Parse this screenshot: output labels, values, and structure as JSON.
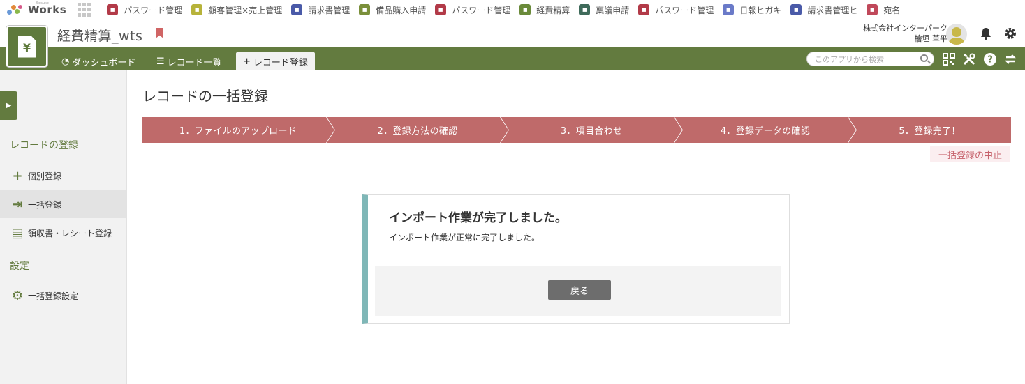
{
  "topbar": {
    "logo_small": "Sosuke",
    "logo_text": "Works",
    "bookmarks": [
      {
        "label": "パスワード管理",
        "icon": "lock-icon",
        "color": "#b23a48"
      },
      {
        "label": "顧客管理×売上管理",
        "icon": "cart-icon",
        "color": "#b7b33a"
      },
      {
        "label": "請求書管理",
        "icon": "invoice-icon",
        "color": "#4a5aa8"
      },
      {
        "label": "備品購入申請",
        "icon": "list-icon",
        "color": "#7a8f3a"
      },
      {
        "label": "パスワード管理",
        "icon": "lock-icon",
        "color": "#b23a48"
      },
      {
        "label": "経費精算",
        "icon": "expense-icon",
        "color": "#6a8a3a"
      },
      {
        "label": "稟議申請",
        "icon": "document-icon",
        "color": "#3f6a5a"
      },
      {
        "label": "パスワード管理",
        "icon": "lock-icon",
        "color": "#b23a48"
      },
      {
        "label": "日報ヒガキ",
        "icon": "notes-icon",
        "color": "#6a7ac8"
      },
      {
        "label": "請求書管理ヒ",
        "icon": "invoice-icon",
        "color": "#4a5aa8"
      },
      {
        "label": "宛名",
        "icon": "compass-icon",
        "color": "#c0485a"
      }
    ]
  },
  "app": {
    "title": "経費精算_wts",
    "icon_glyph": "¥",
    "company": "株式会社インターパーク",
    "user": "檜垣 草平"
  },
  "nav": {
    "tabs": [
      {
        "label": "ダッシュボード",
        "icon": "dashboard-icon",
        "glyph": "◔"
      },
      {
        "label": "レコード一覧",
        "icon": "list-icon",
        "glyph": "☰"
      },
      {
        "label": "レコード登録",
        "icon": "plus-icon",
        "glyph": "+"
      }
    ],
    "search_placeholder": "このアプリから検索"
  },
  "sidebar": {
    "section1": "レコードの登録",
    "items": [
      {
        "label": "個別登録",
        "icon": "plus-icon",
        "glyph": "+"
      },
      {
        "label": "一括登録",
        "icon": "import-icon",
        "glyph": "⇥"
      },
      {
        "label": "領収書・レシート登録",
        "icon": "receipt-icon",
        "glyph": "▤"
      }
    ],
    "section2": "設定",
    "settings_item": {
      "label": "一括登録設定",
      "icon": "gear-icon",
      "glyph": "⚙"
    }
  },
  "main": {
    "page_title": "レコードの一括登録",
    "steps": [
      "1．ファイルのアップロード",
      "2．登録方法の確認",
      "3．項目合わせ",
      "4．登録データの確認",
      "5．登録完了！"
    ],
    "cancel_label": "一括登録の中止",
    "panel": {
      "title": "インポート作業が完了しました。",
      "message": "インポート作業が正常に完了しました。",
      "back_label": "戻る"
    }
  },
  "colors": {
    "brand_green": "#637b3f",
    "step_red": "#bf6a6a",
    "panel_accent": "#7fb7b7"
  }
}
